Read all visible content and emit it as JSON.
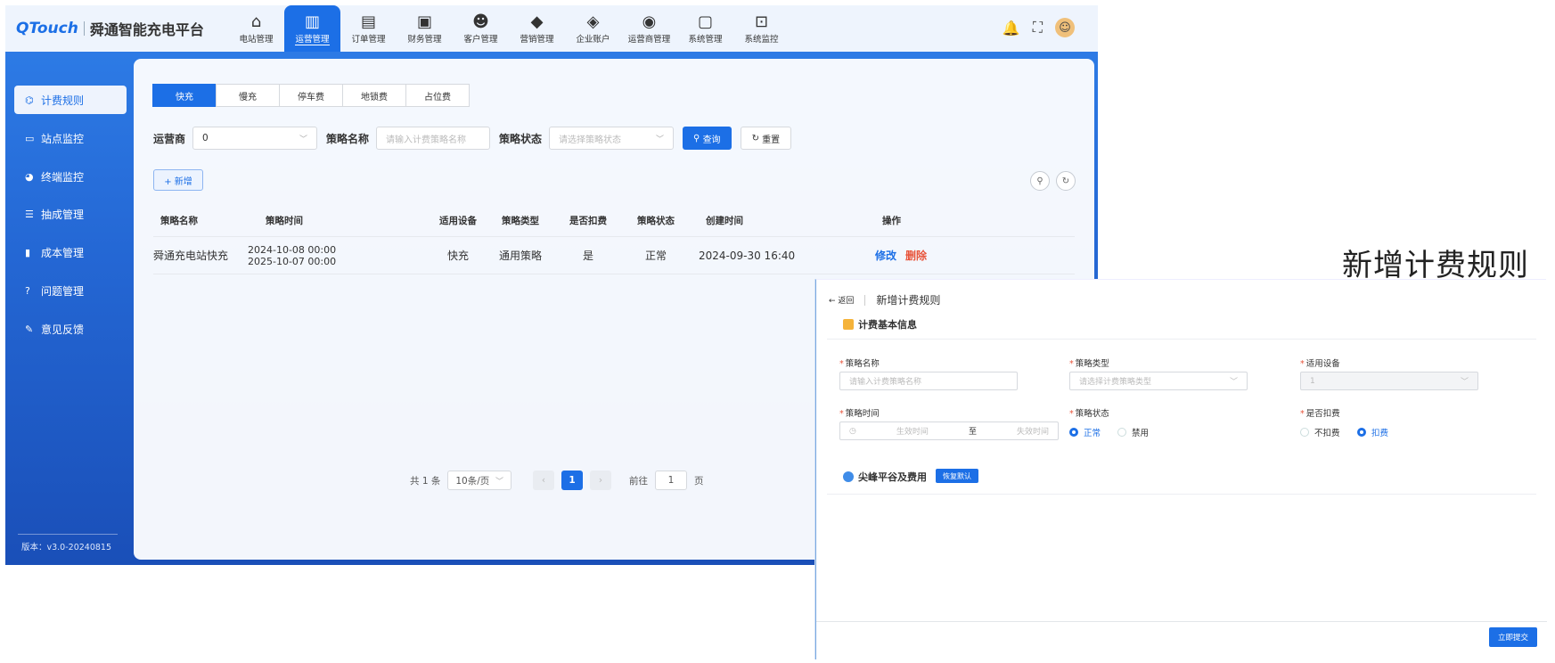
{
  "app": {
    "brand": "QTouch",
    "platform": "舜通智能充电平台"
  },
  "nav": [
    {
      "label": "电站管理",
      "icon": "home-icon"
    },
    {
      "label": "运营管理",
      "icon": "bar-chart-icon",
      "active": true
    },
    {
      "label": "订单管理",
      "icon": "orders-icon"
    },
    {
      "label": "财务管理",
      "icon": "wallet-icon"
    },
    {
      "label": "客户管理",
      "icon": "users-icon"
    },
    {
      "label": "营销管理",
      "icon": "marketing-icon"
    },
    {
      "label": "企业账户",
      "icon": "layers-icon"
    },
    {
      "label": "运营商管理",
      "icon": "operator-icon"
    },
    {
      "label": "系统管理",
      "icon": "monitor-icon"
    },
    {
      "label": "系统监控",
      "icon": "chart-monitor-icon"
    }
  ],
  "sidebar": {
    "items": [
      {
        "label": "计费规则",
        "active": true
      },
      {
        "label": "站点监控"
      },
      {
        "label": "终端监控"
      },
      {
        "label": "抽成管理"
      },
      {
        "label": "成本管理"
      },
      {
        "label": "问题管理"
      },
      {
        "label": "意见反馈"
      }
    ],
    "version": "版本：v3.0-20240815"
  },
  "tabs": [
    "快充",
    "慢充",
    "停车费",
    "地锁费",
    "占位费"
  ],
  "filters": {
    "operator_label": "运营商",
    "operator_value": "0",
    "name_label": "策略名称",
    "name_placeholder": "请输入计费策略名称",
    "status_label": "策略状态",
    "status_placeholder": "请选择策略状态",
    "query": "查询",
    "reset": "重置"
  },
  "add_label": "+ 新增",
  "table": {
    "headers": [
      "策略名称",
      "策略时间",
      "适用设备",
      "策略类型",
      "是否扣费",
      "策略状态",
      "创建时间",
      "操作"
    ],
    "rows": [
      {
        "name": "舜通充电站快充",
        "time_start": "2024-10-08 00:00",
        "time_end": "2025-10-07 00:00",
        "device": "快充",
        "type": "通用策略",
        "deduct": "是",
        "status": "正常",
        "created": "2024-09-30 16:40",
        "edit": "修改",
        "delete": "删除"
      }
    ]
  },
  "pager": {
    "total": "共 1 条",
    "size": "10条/页",
    "page": "1",
    "goto": "前往",
    "goto_value": "1",
    "unit": "页"
  },
  "side_title": "新增计费规则",
  "form": {
    "back": "← 返回",
    "title": "新增计费规则",
    "section_basic": "计费基本信息",
    "name_label": "策略名称",
    "name_placeholder": "请输入计费策略名称",
    "type_label": "策略类型",
    "type_placeholder": "请选择计费策略类型",
    "device_label": "适用设备",
    "device_value": "1",
    "time_label": "策略时间",
    "time_start_ph": "生效时间",
    "time_to": "至",
    "time_end_ph": "失效时间",
    "status_label": "策略状态",
    "status_normal": "正常",
    "status_disabled": "禁用",
    "deduct_label": "是否扣费",
    "deduct_no": "不扣费",
    "deduct_yes": "扣费",
    "section_peak": "尖峰平谷及费用",
    "restore": "恢复默认",
    "submit": "立即提交"
  },
  "colors": {
    "accent": "#1c6fe6",
    "danger": "#e8543a"
  }
}
